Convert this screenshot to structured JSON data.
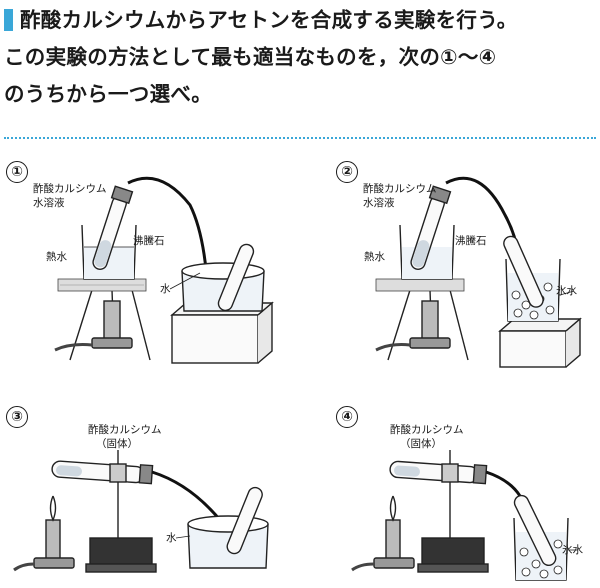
{
  "question": {
    "line1": "酢酸カルシウムからアセトンを合成する実験を行う。",
    "line2": "この実験の方法として最も適当なものを，次の①～④",
    "line3": "のうちから一つ選べ。"
  },
  "panels": [
    {
      "number": "①",
      "labels": {
        "reagent_line1": "酢酸カルシウム",
        "reagent_line2": "水溶液",
        "boiling_chips": "沸騰石",
        "hot_water": "熱水",
        "water": "水"
      }
    },
    {
      "number": "②",
      "labels": {
        "reagent_line1": "酢酸カルシウム",
        "reagent_line2": "水溶液",
        "boiling_chips": "沸騰石",
        "hot_water": "熱水",
        "ice_water": "氷水"
      }
    },
    {
      "number": "③",
      "labels": {
        "reagent_line1": "酢酸カルシウム",
        "reagent_line2": "（固体）",
        "water": "水"
      }
    },
    {
      "number": "④",
      "labels": {
        "reagent_line1": "酢酸カルシウム",
        "reagent_line2": "（固体）",
        "ice_water": "氷水"
      }
    }
  ]
}
